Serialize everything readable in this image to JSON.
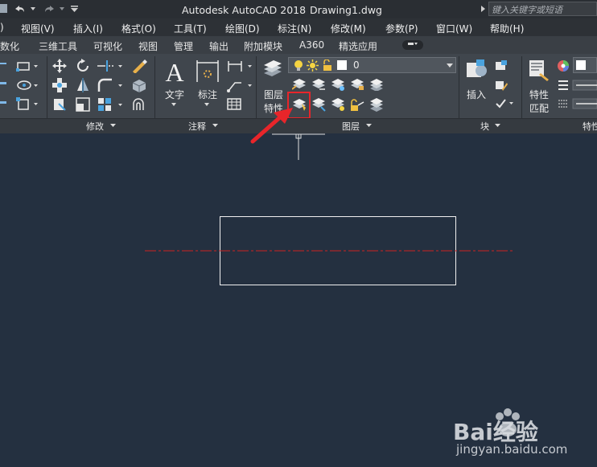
{
  "title": {
    "app": "Autodesk AutoCAD 2018",
    "file": "Drawing1.dwg",
    "search_placeholder": "键入关键字或短语"
  },
  "menu": [
    "视图(V)",
    "插入(I)",
    "格式(O)",
    "工具(T)",
    "绘图(D)",
    "标注(N)",
    "修改(M)",
    "参数(P)",
    "窗口(W)",
    "帮助(H)"
  ],
  "tabs": [
    "参数化",
    "三维工具",
    "可视化",
    "视图",
    "管理",
    "输出",
    "附加模块",
    "A360",
    "精选应用"
  ],
  "ribbon": {
    "text_label": "文字",
    "dim_label": "标注",
    "layer_props_line1": "图层",
    "layer_props_line2": "特性",
    "layer_value": "0",
    "insert_label": "插入",
    "match_line1": "特性",
    "match_line2": "匹配"
  },
  "panels": {
    "modify": "修改",
    "annotation": "注释",
    "layers": "图层",
    "block": "块",
    "properties": "特性"
  },
  "watermark": {
    "brand": "Bai经验",
    "url": "jingyan.baidu.com"
  },
  "colors": {
    "canvas": "#243040",
    "highlight": "#e8252a",
    "centerline": "#cc2222"
  }
}
